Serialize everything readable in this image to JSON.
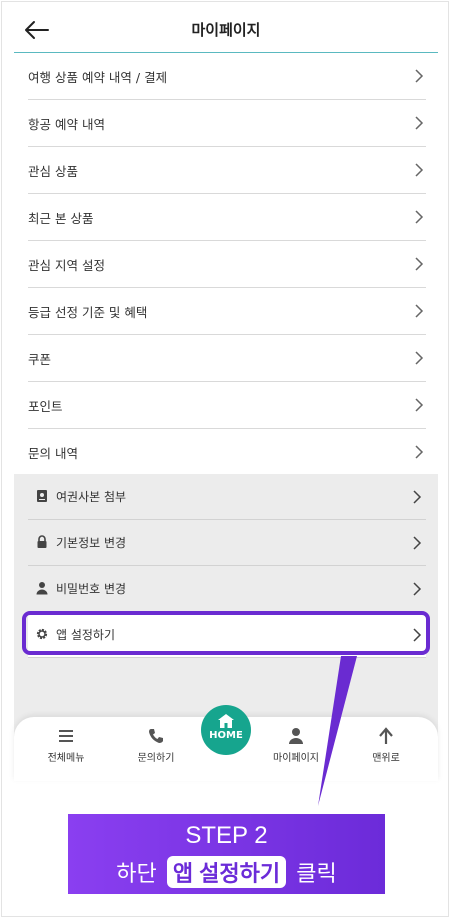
{
  "header": {
    "title": "마이페이지",
    "back_icon": "arrow-left-icon"
  },
  "menu": [
    {
      "label": "여행 상품 예약 내역 / 결제"
    },
    {
      "label": "항공 예약 내역"
    },
    {
      "label": "관심 상품"
    },
    {
      "label": "최근 본 상품"
    },
    {
      "label": "관심 지역 설정"
    },
    {
      "label": "등급 선정 기준 및 혜택"
    },
    {
      "label": "쿠폰"
    },
    {
      "label": "포인트"
    },
    {
      "label": "문의 내역"
    }
  ],
  "submenu": [
    {
      "label": "여권사본 첨부",
      "icon": "passport-icon"
    },
    {
      "label": "기본정보 변경",
      "icon": "lock-icon"
    },
    {
      "label": "비밀번호 변경",
      "icon": "person-icon"
    },
    {
      "label": "앱 설정하기",
      "icon": "gear-icon"
    }
  ],
  "bottom_nav": {
    "items": [
      {
        "label": "전체메뉴",
        "icon": "menu-icon"
      },
      {
        "label": "문의하기",
        "icon": "phone-icon"
      },
      {
        "label": "HOME",
        "icon": "home-icon"
      },
      {
        "label": "마이페이지",
        "icon": "person-icon"
      },
      {
        "label": "맨위로",
        "icon": "arrow-up-icon"
      }
    ]
  },
  "banner": {
    "step": "STEP 2",
    "prefix": "하단",
    "highlight": "앱 설정하기",
    "suffix": "클릭"
  },
  "colors": {
    "accent": "#6a2bd1",
    "home": "#16a58e",
    "header_line": "#5ab9c0"
  }
}
